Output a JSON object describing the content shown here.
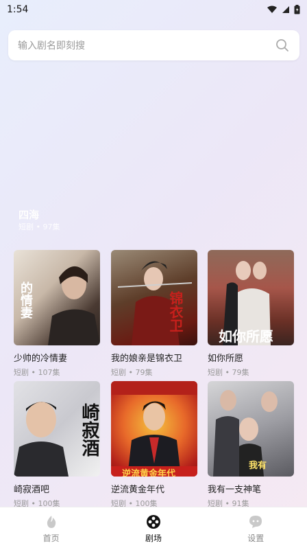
{
  "status": {
    "time": "1:54"
  },
  "search": {
    "placeholder": "输入剧名即刻搜"
  },
  "featured": {
    "title": "四海",
    "meta": "短剧 • 97集"
  },
  "dramas": [
    {
      "title": "少帅的冷情妻",
      "meta": "短剧 • 107集",
      "poster_text": "的情妻"
    },
    {
      "title": "我的娘亲是锦衣卫",
      "meta": "短剧 • 79集",
      "poster_text": "锦衣卫"
    },
    {
      "title": "如你所愿",
      "meta": "短剧 • 79集",
      "poster_text": "如你所愿"
    },
    {
      "title": "崎寂酒吧",
      "meta": "短剧 • 100集",
      "poster_text": "崎寂酒"
    },
    {
      "title": "逆流黄金年代",
      "meta": "短剧 • 100集",
      "poster_text": "逆流黄金年代"
    },
    {
      "title": "我有一支神笔",
      "meta": "短剧 • 91集",
      "poster_text": "我有"
    }
  ],
  "nav": [
    {
      "label": "首页",
      "icon": "flame-icon"
    },
    {
      "label": "剧场",
      "icon": "film-reel-icon"
    },
    {
      "label": "设置",
      "icon": "chat-bubble-icon"
    }
  ]
}
